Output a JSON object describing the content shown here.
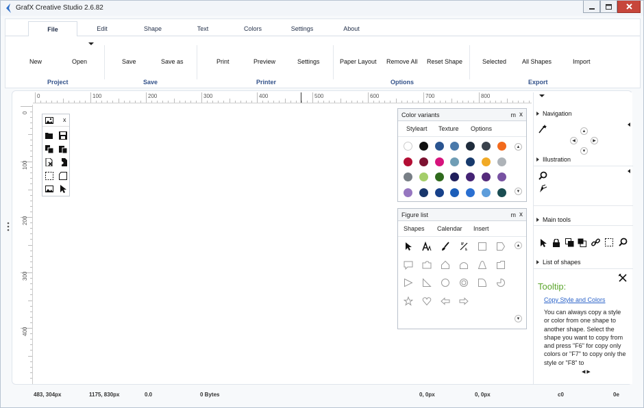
{
  "window": {
    "title": "GrafX Creative Studio 2.6.82"
  },
  "tabs": [
    "File",
    "Edit",
    "Shape",
    "Text",
    "Colors",
    "Settings",
    "About"
  ],
  "ribbon": {
    "buttons": [
      "New",
      "Open",
      "Save",
      "Save as",
      "Print",
      "Preview",
      "Settings",
      "Paper Layout",
      "Remove All",
      "Reset Shape",
      "Selected",
      "All Shapes",
      "Import"
    ],
    "groups": [
      "Project",
      "Save",
      "Printer",
      "Options",
      "Export"
    ]
  },
  "ruler": {
    "h_labels": [
      "0",
      "100",
      "200",
      "300",
      "400",
      "500",
      "600",
      "700",
      "800"
    ],
    "v_labels": [
      "0",
      "100",
      "200",
      "300",
      "400"
    ]
  },
  "color_panel": {
    "title": "Color variants",
    "m": "m",
    "x": "x",
    "tabs": [
      "Styleart",
      "Texture",
      "Options"
    ],
    "colors": [
      "#ffffff",
      "#111111",
      "#2a5490",
      "#4a79aa",
      "#1f2c3c",
      "#3a424c",
      "#f26a1c",
      "#b30e34",
      "#7c1231",
      "#d6137c",
      "#6f9db5",
      "#173a6c",
      "#f1aa26",
      "#aeb3b8",
      "#787f86",
      "#a5ce6a",
      "#2f6a1d",
      "#201f5c",
      "#442374",
      "#552b7b",
      "#7852a2",
      "#9676c0",
      "#18366b",
      "#17418a",
      "#1c5eb9",
      "#2a6fd1",
      "#5d9ddb",
      "#1a4d52"
    ]
  },
  "figure_panel": {
    "title": "Figure list",
    "m": "m",
    "x": "x",
    "tabs": [
      "Shapes",
      "Calendar",
      "Insert"
    ],
    "shapes": [
      "cursor-icon",
      "text-a-icon",
      "brush-icon",
      "ruler-icon",
      "rectangle-icon",
      "pentagon-flag-icon",
      "callout-icon",
      "folder-icon",
      "house-icon",
      "bell-shape-icon",
      "triangle-icon",
      "folder-tab-icon",
      "right-triangle-play-icon",
      "right-angle-triangle-icon",
      "circle-icon",
      "ring-icon",
      "quarter-round-icon",
      "pie-icon",
      "star-icon",
      "heart-icon",
      "arrow-left-icon",
      "arrow-right-icon"
    ]
  },
  "right_panel": {
    "sections": [
      "Navigation",
      "Illustration",
      "Main tools",
      "List of shapes"
    ],
    "tooltip_title": "Tooltip:",
    "tooltip_link": "Copy Style and Colors",
    "tooltip_body": "You can always copy a style or color from one shape to another shape. Select the shape you want to copy from and press \"F6\" for copy only colors or \"F7\" to copy only the style or \"F8\" to"
  },
  "status": [
    "483, 304px",
    "1175, 830px",
    "0.0",
    "0 Bytes",
    "0, 0px",
    "0, 0px",
    "c0",
    "0e"
  ]
}
